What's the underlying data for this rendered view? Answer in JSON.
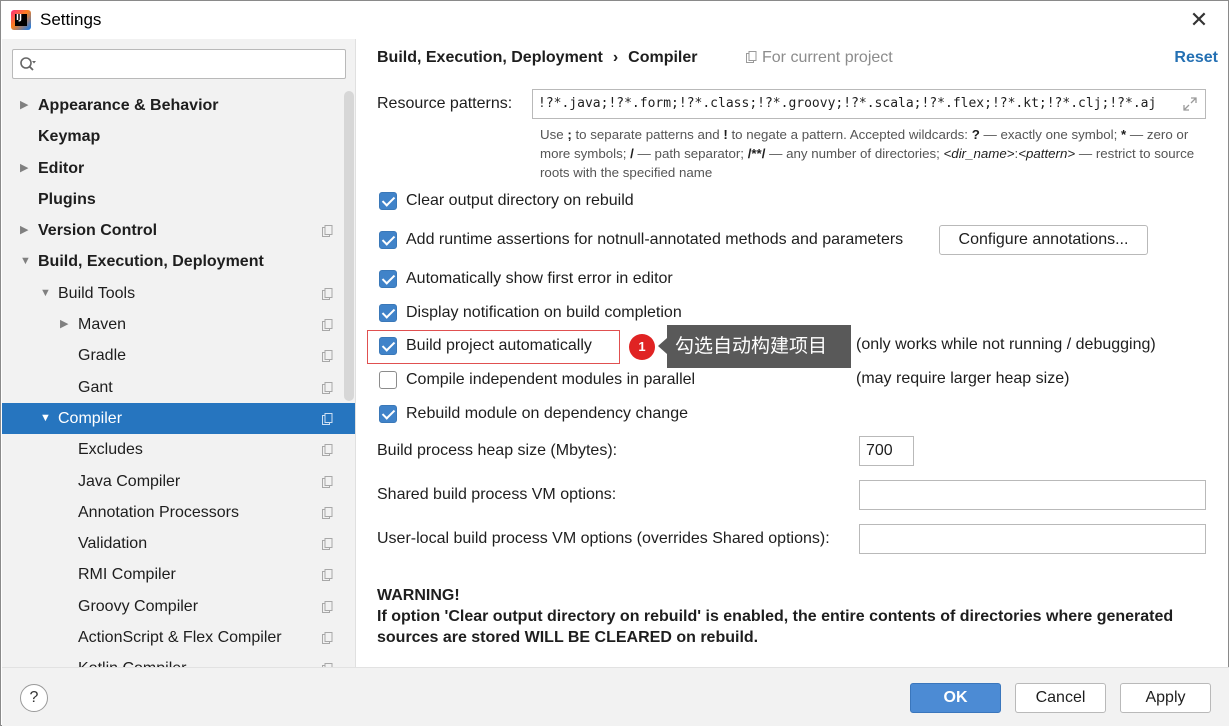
{
  "window": {
    "title": "Settings"
  },
  "sidebar": {
    "search_placeholder": "",
    "items": [
      {
        "label": "Appearance & Behavior",
        "level": 0,
        "bold": true,
        "arrow": "right",
        "copy": false,
        "selected": false
      },
      {
        "label": "Keymap",
        "level": 0,
        "bold": true,
        "arrow": "",
        "copy": false,
        "selected": false
      },
      {
        "label": "Editor",
        "level": 0,
        "bold": true,
        "arrow": "right",
        "copy": false,
        "selected": false
      },
      {
        "label": "Plugins",
        "level": 0,
        "bold": true,
        "arrow": "",
        "copy": false,
        "selected": false
      },
      {
        "label": "Version Control",
        "level": 0,
        "bold": true,
        "arrow": "right",
        "copy": true,
        "selected": false
      },
      {
        "label": "Build, Execution, Deployment",
        "level": 0,
        "bold": true,
        "arrow": "down",
        "copy": false,
        "selected": false
      },
      {
        "label": "Build Tools",
        "level": 1,
        "bold": false,
        "arrow": "down",
        "copy": true,
        "selected": false
      },
      {
        "label": "Maven",
        "level": 2,
        "bold": false,
        "arrow": "right",
        "copy": true,
        "selected": false
      },
      {
        "label": "Gradle",
        "level": 2,
        "bold": false,
        "arrow": "",
        "copy": true,
        "selected": false
      },
      {
        "label": "Gant",
        "level": 2,
        "bold": false,
        "arrow": "",
        "copy": true,
        "selected": false
      },
      {
        "label": "Compiler",
        "level": 1,
        "bold": false,
        "arrow": "down",
        "copy": true,
        "selected": true
      },
      {
        "label": "Excludes",
        "level": 2,
        "bold": false,
        "arrow": "",
        "copy": true,
        "selected": false
      },
      {
        "label": "Java Compiler",
        "level": 2,
        "bold": false,
        "arrow": "",
        "copy": true,
        "selected": false
      },
      {
        "label": "Annotation Processors",
        "level": 2,
        "bold": false,
        "arrow": "",
        "copy": true,
        "selected": false
      },
      {
        "label": "Validation",
        "level": 2,
        "bold": false,
        "arrow": "",
        "copy": true,
        "selected": false
      },
      {
        "label": "RMI Compiler",
        "level": 2,
        "bold": false,
        "arrow": "",
        "copy": true,
        "selected": false
      },
      {
        "label": "Groovy Compiler",
        "level": 2,
        "bold": false,
        "arrow": "",
        "copy": true,
        "selected": false
      },
      {
        "label": "ActionScript & Flex Compiler",
        "level": 2,
        "bold": false,
        "arrow": "",
        "copy": true,
        "selected": false
      },
      {
        "label": "Kotlin Compiler",
        "level": 2,
        "bold": false,
        "arrow": "",
        "copy": true,
        "selected": false
      }
    ]
  },
  "header": {
    "crumb1": "Build, Execution, Deployment",
    "crumb_sep": "›",
    "crumb2": "Compiler",
    "scope": "For current project",
    "reset": "Reset"
  },
  "resource": {
    "label": "Resource patterns:",
    "value": "!?*.java;!?*.form;!?*.class;!?*.groovy;!?*.scala;!?*.flex;!?*.kt;!?*.clj;!?*.aj",
    "hint_parts": {
      "p1": "Use ",
      "b1": ";",
      "p2": " to separate patterns and ",
      "b2": "!",
      "p3": " to negate a pattern. Accepted wildcards: ",
      "b3": "?",
      "p4": " — exactly one symbol; ",
      "b4": "*",
      "p5": " — zero or more symbols; ",
      "b5": "/",
      "p6": " — path separator; ",
      "b6": "/**/",
      "p7": " — any number of directories; ",
      "i1": "<dir_name>",
      "p8": ":",
      "i2": "<pattern>",
      "p9": " — restrict to source roots with the specified name"
    }
  },
  "options": {
    "clear_output": {
      "label": "Clear output directory on rebuild",
      "checked": true
    },
    "runtime_assertions": {
      "label": "Add runtime assertions for notnull-annotated methods and parameters",
      "checked": true
    },
    "configure_annotations": "Configure annotations...",
    "show_first_error": {
      "label": "Automatically show first error in editor",
      "checked": true
    },
    "notify_completion": {
      "label": "Display notification on build completion",
      "checked": true
    },
    "build_auto": {
      "label": "Build project automatically",
      "checked": true,
      "note": "(only works while not running / debugging)"
    },
    "parallel": {
      "label": "Compile independent modules in parallel",
      "checked": false,
      "note": "(may require larger heap size)"
    },
    "rebuild_dep": {
      "label": "Rebuild module on dependency change",
      "checked": true
    }
  },
  "annotation": {
    "badge": "1",
    "text": "勾选自动构建项目"
  },
  "heap": {
    "label": "Build process heap size (Mbytes):",
    "value": "700"
  },
  "shared_vm": {
    "label": "Shared build process VM options:",
    "value": ""
  },
  "user_vm": {
    "label": "User-local build process VM options (overrides Shared options):",
    "value": ""
  },
  "warning": {
    "title": "WARNING!",
    "body": "If option 'Clear output directory on rebuild' is enabled, the entire contents of directories where generated sources are stored WILL BE CLEARED on rebuild."
  },
  "footer": {
    "help": "?",
    "ok": "OK",
    "cancel": "Cancel",
    "apply": "Apply"
  }
}
